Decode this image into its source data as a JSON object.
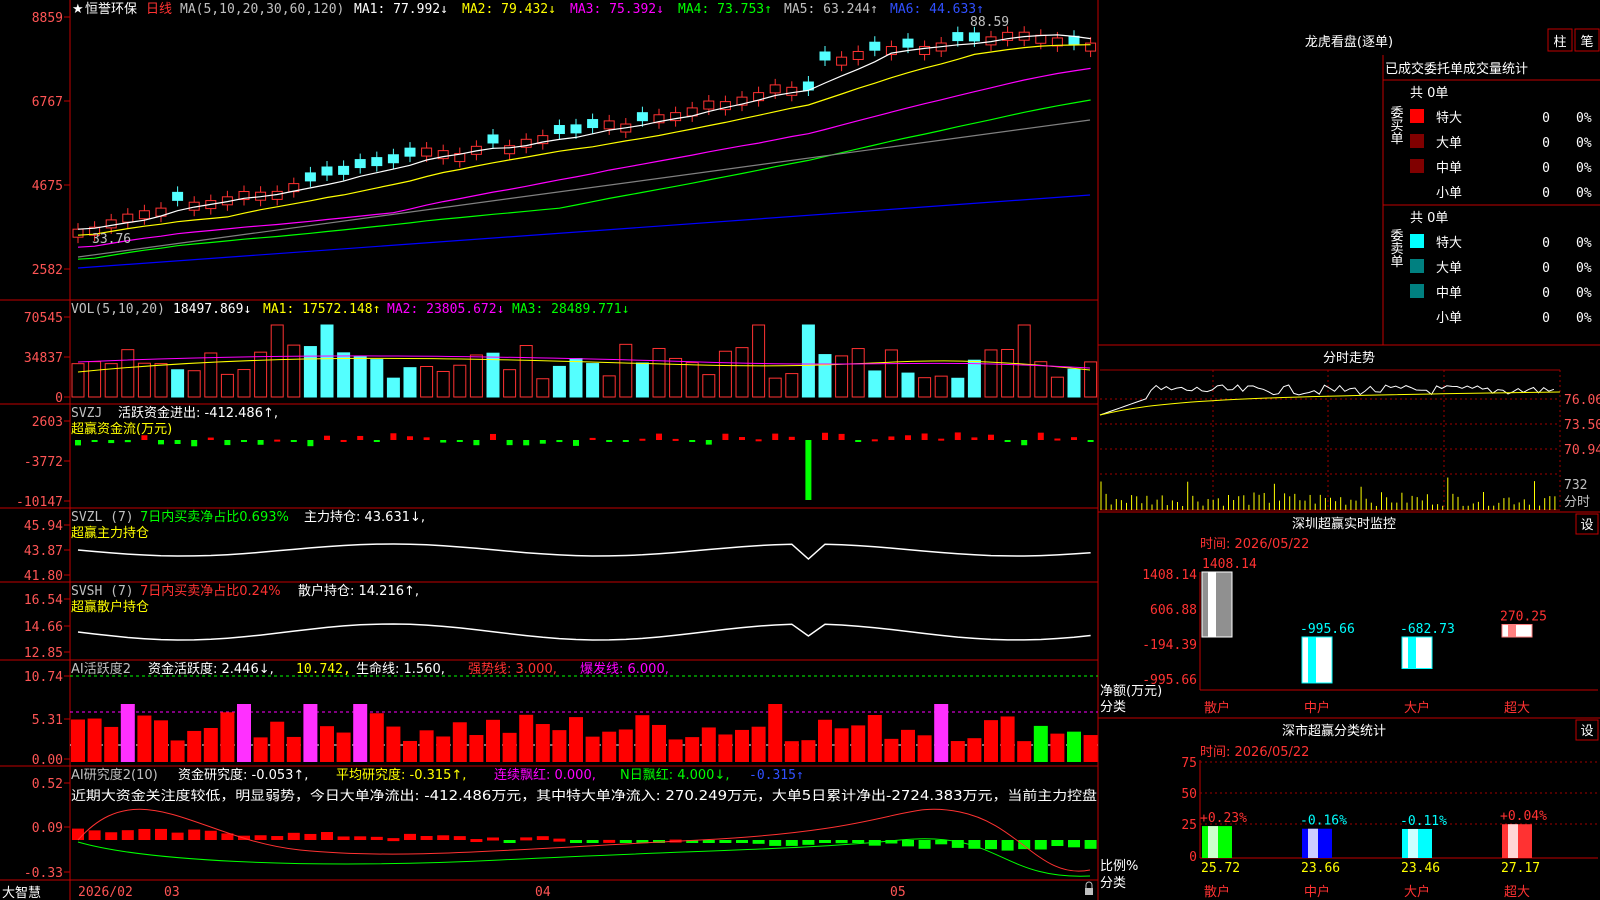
{
  "header": {
    "star": "★",
    "stock_name": "恒誉环保",
    "period": "日线",
    "ma_params": "MA(5,10,20,30,60,120)",
    "ma1": "MA1: 77.992↓",
    "ma2": "MA2: 79.432↓",
    "ma3": "MA3: 75.392↓",
    "ma4": "MA4: 73.753↑",
    "ma5": "MA5: 63.244↑",
    "ma6": "MA6: 44.633↑",
    "peak_label": "88.59",
    "low_label": "33.76"
  },
  "price_axis": [
    "8859",
    "6767",
    "4675",
    "2582"
  ],
  "vol_panel": {
    "title": "VOL(5,10,20)",
    "vol": "18497.869↓",
    "ma1": "MA1: 17572.148↑",
    "ma2": "MA2: 23805.672↓",
    "ma3": "MA3: 28489.771↓",
    "axis": [
      "70545",
      "34837",
      "0"
    ]
  },
  "svzj_panel": {
    "title": "SVZJ",
    "desc": "活跃资金进出: -412.486↑,",
    "sub": "超赢资金流(万元)",
    "axis": [
      "2603",
      "-3772",
      "-10147"
    ]
  },
  "svzl_panel": {
    "title": "SVZL (7)",
    "desc1": "7日内买卖净占比0.693%",
    "desc2": "主力持仓: 43.631↓,",
    "sub": "超赢主力持仓",
    "axis": [
      "45.94",
      "43.87",
      "41.80"
    ]
  },
  "svsh_panel": {
    "title": "SVSH (7)",
    "desc1": "7日内买卖净占比0.24%",
    "desc2": "散户持仓: 14.216↑,",
    "sub": "超赢散户持仓",
    "axis": [
      "16.54",
      "14.66",
      "12.85"
    ]
  },
  "ai1_panel": {
    "title": "AI活跃度2",
    "d1": "资金活跃度: 2.446↓,",
    "d2": "10.742,",
    "d3": "生命线: 1.560,",
    "d4": "强势线: 3.000,",
    "d5": "爆发线: 6.000,",
    "axis": [
      "10.74",
      "5.31",
      "0.00"
    ]
  },
  "ai2_panel": {
    "title": "AI研究度2(10)",
    "d1": "资金研究度: -0.053↑,",
    "d2": "平均研究度: -0.315↑,",
    "d3": "连续飘红: 0.000,",
    "d4": "N日飘红: 4.000↓,",
    "d5": "-0.315↑",
    "note": "近期大资金关注度较低，明显弱势，今日大单净流出: -412.486万元，其中特大单净流入: 270.249万元，大单5日累计净出-2724.383万元，当前主力控盘",
    "axis": [
      "0.52",
      "0.09",
      "-0.33"
    ]
  },
  "bottom_bar": {
    "brand": "大智慧",
    "dates": [
      "2026/02",
      "03",
      "04",
      "05"
    ]
  },
  "right_panel": {
    "title": "龙虎看盘(逐单)",
    "btn_zhu": "柱",
    "btn_bi": "笔",
    "tabs": "已成交委托单成交量统计",
    "buy_label": "委买单",
    "sell_label": "委卖单",
    "buy_total": "共 0单",
    "sell_total": "共 0单",
    "buy_rows": [
      {
        "name": "特大",
        "count": "0",
        "pct": "0%",
        "color": "#ff0000"
      },
      {
        "name": "大单",
        "count": "0",
        "pct": "0%",
        "color": "#800000"
      },
      {
        "name": "中单",
        "count": "0",
        "pct": "0%",
        "color": "#800000"
      },
      {
        "name": "小单",
        "count": "0",
        "pct": "0%",
        "color": "#000000"
      }
    ],
    "sell_rows": [
      {
        "name": "特大",
        "count": "0",
        "pct": "0%",
        "color": "#00ffff"
      },
      {
        "name": "大单",
        "count": "0",
        "pct": "0%",
        "color": "#008080"
      },
      {
        "name": "中单",
        "count": "0",
        "pct": "0%",
        "color": "#008080"
      },
      {
        "name": "小单",
        "count": "0",
        "pct": "0%",
        "color": "#000000"
      }
    ],
    "intraday_title": "分时走势",
    "intraday_axis": [
      "76.06",
      "73.50",
      "70.94"
    ],
    "intraday_vol_axis": [
      "732",
      "分时"
    ],
    "monitor_title": "深圳超赢实时监控",
    "monitor_btn": "设",
    "monitor_time": "时间: 2026/05/22",
    "monitor_axis": [
      "1408.14",
      "606.88",
      "-194.39",
      "-995.66"
    ],
    "monitor_ylabel": "净额(万元)",
    "monitor_xlabel": "分类",
    "monitor_bars": [
      {
        "cat": "散户",
        "value": "1408.14"
      },
      {
        "cat": "中户",
        "value": "-995.66"
      },
      {
        "cat": "大户",
        "value": "-682.73"
      },
      {
        "cat": "超大",
        "value": "270.25"
      }
    ],
    "stats_title": "深市超赢分类统计",
    "stats_btn": "设",
    "stats_time": "时间: 2026/05/22",
    "stats_axis": [
      "75",
      "50",
      "25",
      "0"
    ],
    "stats_ylabel": "比例%",
    "stats_xlabel": "分类",
    "stats_bars": [
      {
        "cat": "散户",
        "value": "25.72",
        "chg": "+0.23%"
      },
      {
        "cat": "中户",
        "value": "23.66",
        "chg": "-0.16%"
      },
      {
        "cat": "大户",
        "value": "23.46",
        "chg": "-0.11%"
      },
      {
        "cat": "超大",
        "value": "27.17",
        "chg": "+0.04%"
      }
    ]
  },
  "colors": {
    "up": "#ff3232",
    "down": "#54ffff",
    "grid": "#a00000",
    "axis_text": "#ff5555",
    "ma1": "#ffffff",
    "ma2": "#ffff00",
    "ma3": "#ff00ff",
    "ma4": "#00ff00",
    "ma5": "#808080",
    "ma6": "#0000ff"
  }
}
